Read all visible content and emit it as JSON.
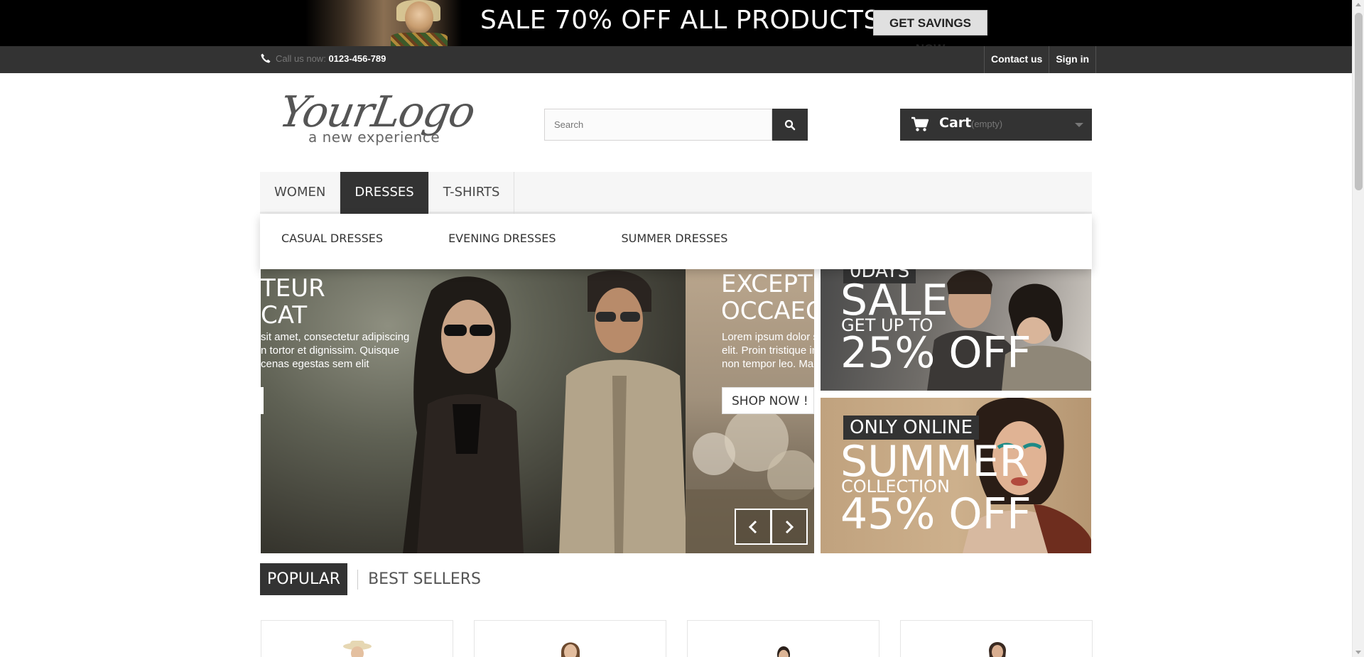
{
  "promo": {
    "headline": "SALE 70% OFF ALL PRODUCTS",
    "button_label": "GET SAVINGS NOW"
  },
  "topbar": {
    "call_label": "Call us now:",
    "phone": "0123-456-789",
    "links": [
      "Contact us",
      "Sign in"
    ]
  },
  "header": {
    "logo_text": "YourLogo",
    "logo_tagline": "a new experience",
    "search_placeholder": "Search",
    "cart_label": "Cart",
    "cart_status": "(empty)"
  },
  "menu": {
    "items": [
      "WOMEN",
      "DRESSES",
      "T-SHIRTS"
    ],
    "active": "DRESSES",
    "submenu": [
      "CASUAL DRESSES",
      "EVENING DRESSES",
      "SUMMER DRESSES"
    ]
  },
  "slider": {
    "slide1_heading_line1": "TEUR",
    "slide1_heading_line2": "CAT",
    "slide1_body_line1": "sit amet, consectetur adipiscing",
    "slide1_body_line2": "n tortor et dignissim. Quisque",
    "slide1_body_line3": "cenas egestas sem elit",
    "slide2_heading_line1": "EXCEPT",
    "slide2_heading_line2": "OCCAEC",
    "slide2_body_line1": "Lorem ipsum dolor s",
    "slide2_body_line2": "elit. Proin tristique in",
    "slide2_body_line3": "non tempor leo. Mae",
    "shop_button": "SHOP NOW !"
  },
  "banners": {
    "banner1": {
      "tag": "0DAYS",
      "big": "SALE",
      "small": "GET UP TO",
      "offer": "25% OFF"
    },
    "banner2": {
      "tag": "ONLY ONLINE",
      "big": "SUMMER",
      "small": "COLLECTION",
      "offer": "45% OFF"
    }
  },
  "tabs": [
    "POPULAR",
    "BEST SELLERS"
  ],
  "colors": {
    "dark": "#333333",
    "topbar": "#333333",
    "menu_bg": "#f6f6f6",
    "promo_bg": "#000000"
  },
  "icons": {
    "phone": "phone-icon",
    "search": "search-icon",
    "cart": "cart-icon",
    "prev": "chevron-left-icon",
    "next": "chevron-right-icon"
  }
}
